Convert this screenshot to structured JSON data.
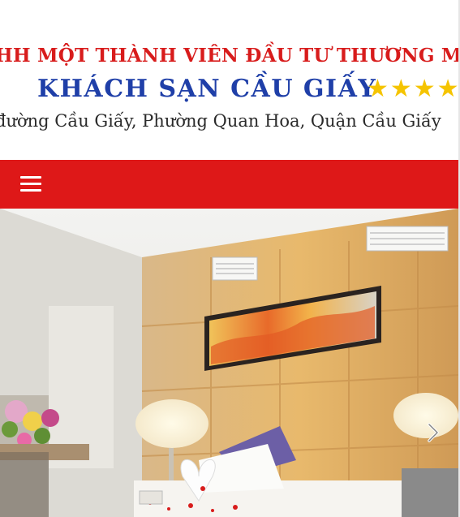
{
  "header": {
    "company_name": "HH MỘT THÀNH VIÊN ĐẦU TƯ THƯƠNG MẠI",
    "hotel_name": "KHÁCH SẠN CẦU GIẤY",
    "stars": "★★★★",
    "address": "đường Cầu Giấy, Phường Quan Hoa, Quận Cầu Giấy"
  },
  "navbar": {
    "menu_icon": "hamburger-menu-icon",
    "background_color": "#de1818"
  },
  "slider": {
    "next_icon": "chevron-right-icon"
  },
  "colors": {
    "company_text": "#d81c1c",
    "hotel_text": "#1f3fa8",
    "star": "#f5c400"
  }
}
